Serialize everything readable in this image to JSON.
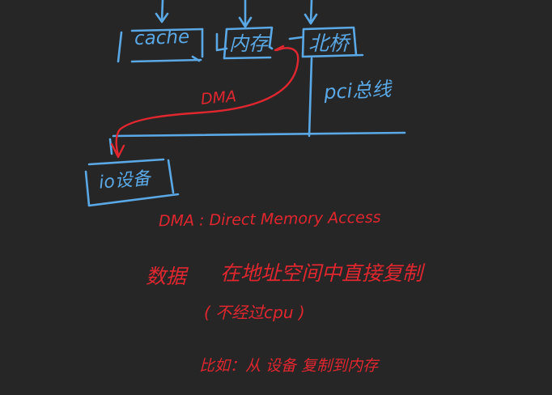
{
  "colors": {
    "background": "#262626",
    "blue_ink": "#5aa9e6",
    "red_ink": "#e0262f"
  },
  "diagram": {
    "boxes": {
      "cache": "cache",
      "memory": "内存",
      "northbridge": "北桥",
      "io_device": "io设备"
    },
    "bus_label": "pci总线",
    "dma_arrow_label": "DMA"
  },
  "notes": {
    "definition": "DMA : Direct Memory Access",
    "data_label": "数据",
    "data_description": "在地址空间中直接复制",
    "cpu_note": "( 不经过cpu )",
    "example": "比如：从 设备 复制到内存"
  }
}
